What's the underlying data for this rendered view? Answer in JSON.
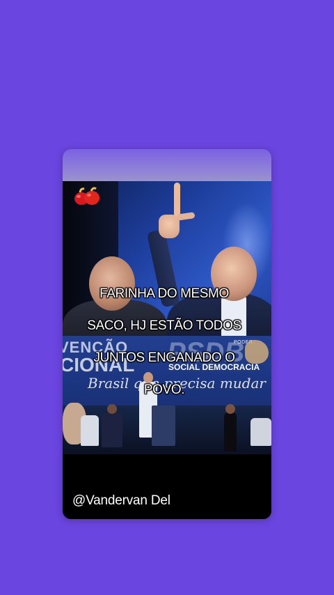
{
  "background_color": "#6a45df",
  "story": {
    "caption_lines": [
      "FARINHA DO MESMO",
      "SACO, HJ ESTÃO TODOS",
      "JUNTOS ENGANADO O",
      "POVO."
    ],
    "username": "@Vandervan Del",
    "logo_icon": "red-peppers-logo-icon",
    "photo_banner": {
      "convencao": "VENÇÃO",
      "nacional": "CIONAL",
      "party": "PSDB",
      "party_subtitle": "SOCIAL DEMOCRACIA",
      "slogan": "Brasil que precisa mudar",
      "poder_badge": "PODER"
    }
  }
}
